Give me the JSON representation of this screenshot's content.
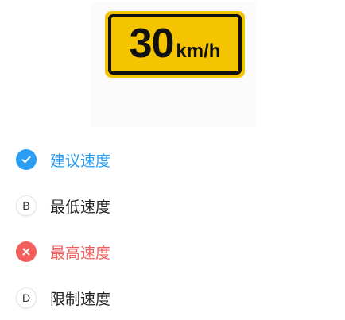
{
  "question_image": {
    "sign_number": "30",
    "sign_unit": "km/h",
    "sign_color": "#f5c400"
  },
  "options": [
    {
      "key": "A",
      "label": "建议速度",
      "state": "correct",
      "icon": "check-icon",
      "color": "#2a9df4"
    },
    {
      "key": "B",
      "label": "最低速度",
      "state": "neutral"
    },
    {
      "key": "C",
      "label": "最高速度",
      "state": "wrong",
      "icon": "cross-icon",
      "color": "#f25f5c"
    },
    {
      "key": "D",
      "label": "限制速度",
      "state": "neutral"
    }
  ]
}
